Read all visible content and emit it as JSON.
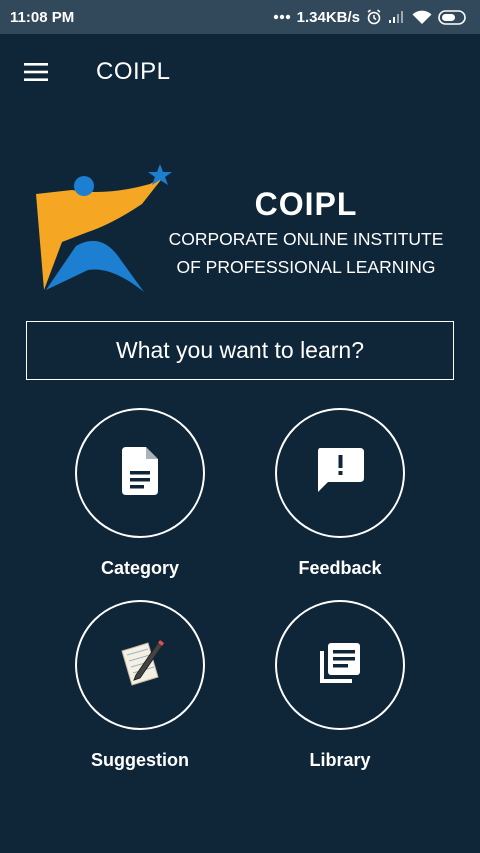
{
  "status_bar": {
    "time": "11:08 PM",
    "network_speed": "1.34KB/s",
    "icons": [
      "dots-icon",
      "alarm-icon",
      "signal-icon",
      "wifi-icon",
      "battery-icon"
    ]
  },
  "app_bar": {
    "title": "COIPL",
    "menu_icon": "hamburger-menu-icon"
  },
  "brand": {
    "name": "COIPL",
    "subtitle_line1": "CORPORATE ONLINE INSTITUTE",
    "subtitle_line2": "OF PROFESSIONAL LEARNING"
  },
  "search": {
    "placeholder": "What you want to learn?",
    "value": ""
  },
  "tiles": [
    {
      "label": "Category",
      "icon": "document-icon"
    },
    {
      "label": "Feedback",
      "icon": "feedback-icon"
    },
    {
      "label": "Suggestion",
      "icon": "notepad-pencil-icon"
    },
    {
      "label": "Library",
      "icon": "library-icon"
    }
  ],
  "colors": {
    "background": "#0f2638",
    "status_bar": "#31495b",
    "logo_orange": "#f5a623",
    "logo_blue": "#1c7fd1",
    "text": "#ffffff"
  }
}
